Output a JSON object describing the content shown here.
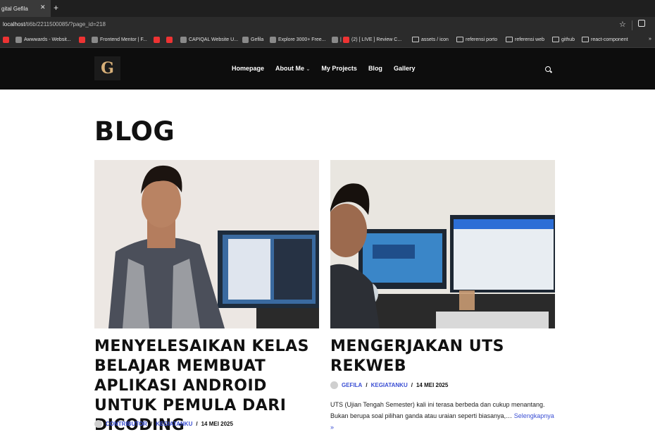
{
  "browser": {
    "tab_title": "gital Gefila",
    "url_host": "localhost",
    "url_path": "/ti6b/2211500085/?page_id=218",
    "bookmarks": [
      {
        "label": "",
        "icon": "youtube-icon"
      },
      {
        "label": "Awwwards - Websit...",
        "icon": "awwwards-icon"
      },
      {
        "label": "",
        "icon": "youtube-icon"
      },
      {
        "label": "Frontend Mentor | F...",
        "icon": "frontend-mentor-icon"
      },
      {
        "label": "",
        "icon": "youtube-icon"
      },
      {
        "label": "",
        "icon": "youtube-icon"
      },
      {
        "label": "CAPIQAL Website U...",
        "icon": "capiqal-icon"
      },
      {
        "label": "Gefila",
        "icon": "github-icon"
      },
      {
        "label": "Explore 3000+ Free...",
        "icon": "ui-icon"
      },
      {
        "label": "|",
        "icon": "app-icon"
      },
      {
        "label": "(2) [ LIVE ] Review C...",
        "icon": "youtube-icon"
      },
      {
        "label": "assets / icon",
        "icon": "folder-icon"
      },
      {
        "label": "referensi porto",
        "icon": "folder-icon"
      },
      {
        "label": "referensi web",
        "icon": "folder-icon"
      },
      {
        "label": "github",
        "icon": "folder-icon"
      },
      {
        "label": "react-component",
        "icon": "folder-icon"
      }
    ],
    "more": "»"
  },
  "site": {
    "nav": [
      "Homepage",
      "About Me",
      "My Projects",
      "Blog",
      "Gallery"
    ],
    "about_caret": "⌄"
  },
  "page": {
    "title": "BLOG",
    "posts": [
      {
        "title": "MENYELESAIKAN KELAS BELAJAR MEMBUAT APLIKASI ANDROID UNTUK PEMULA DARI DICODING",
        "author": "CONTRIBUTOR",
        "category": "KEGIATANKU",
        "date": "14 MEI 2025"
      },
      {
        "title": "MENGERJAKAN UTS REKWEB",
        "author": "GEFILA",
        "category": "KEGIATANKU",
        "date": "14 MEI 2025",
        "excerpt": "UTS (Ujian Tengah Semester) kali ini terasa berbeda dan cukup menantang. Bukan berupa soal pilihan ganda atau uraian seperti biasanya,…",
        "read_more": "Selengkapnya »"
      }
    ]
  },
  "colors": {
    "accent_link": "#3b4fd4",
    "header_bg": "#0d0d0d",
    "logo_gold": "#d8b079"
  }
}
